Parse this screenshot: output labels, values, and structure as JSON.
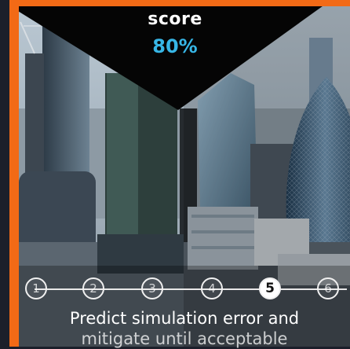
{
  "score": {
    "label": "score",
    "value": "80%"
  },
  "timeline": {
    "steps": [
      "1",
      "2",
      "3",
      "4",
      "5",
      "6"
    ],
    "active_step": "5"
  },
  "caption": {
    "line1": "Predict simulation error and",
    "line2": "mitigate until acceptable"
  },
  "colors": {
    "accent_frame": "#f26a16",
    "score_value": "#37b6e6",
    "overlay": "#050505"
  }
}
